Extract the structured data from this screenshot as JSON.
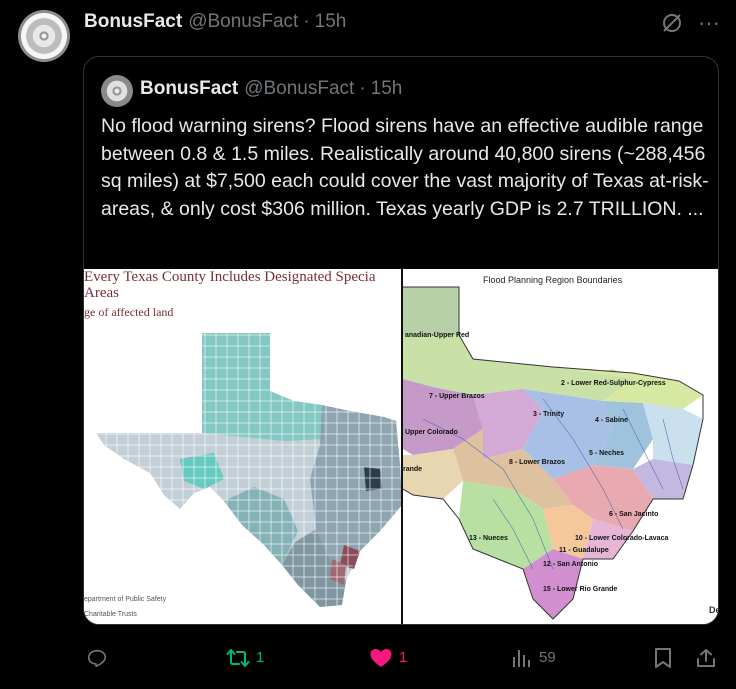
{
  "tweet": {
    "author_name": "BonusFact",
    "author_handle": "@BonusFact",
    "separator": "·",
    "time": "15h",
    "more_label": "···"
  },
  "quoted": {
    "author_name": "BonusFact",
    "author_handle": "@BonusFact",
    "separator": "·",
    "time": "15h",
    "text": "No flood warning sirens? Flood sirens have an effective audible range between 0.8 & 1.5 miles. Realistically around 40,800 sirens (~288,456 sq miles) at $7,500 each could cover the vast majority of Texas at-risk-areas, & only cost $306 million. Texas yearly GDP is 2.7 TRILLION.  ...",
    "media": {
      "left_map": {
        "title_line1": "Every Texas County Includes Designated Specia",
        "title_line2": " Areas",
        "subtitle": "ge of affected land",
        "source_line1": "epartment of Public Safety",
        "source_line2": "Charitable Trusts"
      },
      "right_map": {
        "title": "Flood Planning Region Boundaries",
        "logo": "De",
        "regions": [
          "anadian-Upper Red",
          "2 - Lower Red-Sulphur-Cypress",
          "7 - Upper Brazos",
          "3 - Trinity",
          "4 - Sabine",
          "Upper Colorado",
          "5 - Neches",
          "rande",
          "8 - Lower Brazos",
          "6 - San Jacinto",
          "13 - Nueces",
          "10 - Lower Colorado-Lavaca",
          "11 - Guadalupe",
          "12 - San Antonio",
          "15 - Lower Rio Grande"
        ]
      }
    }
  },
  "actions": {
    "reply_count": "",
    "retweet_count": "1",
    "like_count": "1",
    "views_count": "59",
    "colors": {
      "retweet": "#00ba7c",
      "like": "#f91880",
      "muted": "#71767b"
    }
  }
}
